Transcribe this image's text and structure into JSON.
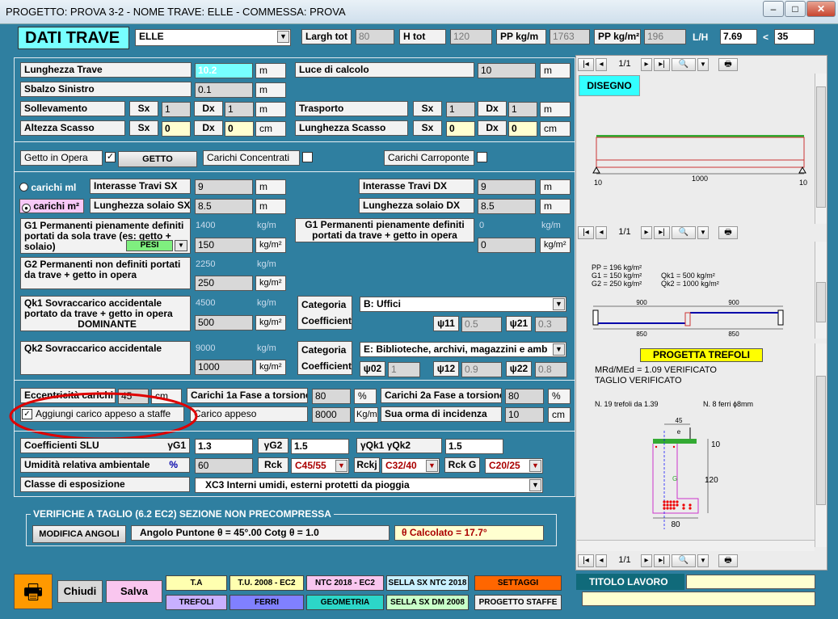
{
  "window": {
    "title": "PROGETTO: PROVA 3-2 - NOME TRAVE: ELLE - COMMESSA: PROVA",
    "min": "–",
    "max": "□",
    "close": "✕"
  },
  "header": {
    "title": "DATI TRAVE",
    "trave": "ELLE",
    "largh_tot_label": "Largh tot",
    "largh_tot": "80",
    "h_tot_label": "H tot",
    "h_tot": "120",
    "pp_kgm_label": "PP kg/m",
    "pp_kgm": "1763",
    "pp_kgm2_label": "PP kg/m²",
    "pp_kgm2": "196",
    "lh_label": "L/H",
    "lh": "7.69",
    "lt": "<",
    "lh_limit": "35"
  },
  "geom": {
    "lunghezza_label": "Lunghezza Trave",
    "lunghezza": "10.2",
    "m": "m",
    "luce_label": "Luce di calcolo",
    "luce": "10",
    "sbalzo_label": "Sbalzo Sinistro",
    "sbalzo": "0.1",
    "sollevamento_label": "Sollevamento",
    "sx": "Sx",
    "dx": "Dx",
    "soll_sx": "1",
    "soll_dx": "1",
    "trasporto_label": "Trasporto",
    "tras_sx": "1",
    "tras_dx": "1",
    "scasso_label": "Altezza Scasso",
    "scasso_sx": "0",
    "scasso_dx": "0",
    "cm": "cm",
    "lscasso_label": "Lunghezza Scasso",
    "lscasso_sx": "0",
    "lscasso_dx": "0"
  },
  "getto": {
    "getto_label": "Getto in Opera",
    "getto_checked": "✓",
    "getto_btn": "GETTO",
    "conc_label": "Carichi Concentrati",
    "carroponte_label": "Carichi Carroponte"
  },
  "loads": {
    "carichi_ml": "carichi ml",
    "carichi_m2": "carichi m²",
    "int_sx_label": "Interasse Travi SX",
    "int_sx": "9",
    "int_dx_label": "Interasse Travi DX",
    "int_dx": "9",
    "lsol_sx_label": "Lunghezza solaio SX",
    "lsol_sx": "8.5",
    "lsol_dx_label": "Lunghezza solaio DX",
    "lsol_dx": "8.5",
    "m": "m",
    "g1_label": "G1  Permanenti pienamente definiti portati da sola trave (es: getto + solaio)",
    "pesi_btn": "PESI",
    "g1_kgm": "1400",
    "kgm": "kg/m",
    "g1_kgm2": "150",
    "kgm2": "kg/m²",
    "g1b_label": "G1  Permanenti pienamente definiti portati da trave + getto in opera",
    "g1b_kgm": "0",
    "g1b_kgm2": "0",
    "g2_label": "G2  Permanenti non definiti portati da trave + getto in opera",
    "g2_kgm": "2250",
    "g2_kgm2": "250",
    "qk1_label": "Qk1   Sovraccarico accidentale portato da trave + getto in opera",
    "qk1_dom": "DOMINANTE",
    "qk1_kgm": "4500",
    "qk1_kgm2": "500",
    "categoria": "Categoria",
    "coefficienti": "Coefficienti",
    "cat1": "B: Uffici",
    "psi11_label": "ψ11",
    "psi11": "0.5",
    "psi21_label": "ψ21",
    "psi21": "0.3",
    "qk2_label": "Qk2  Sovraccarico accidentale",
    "qk2_kgm": "9000",
    "qk2_kgm2": "1000",
    "cat2": "E: Biblioteche, archivi, magazzini e amb",
    "psi02_label": "ψ02",
    "psi02": "1",
    "psi12_label": "ψ12",
    "psi12": "0.9",
    "psi22_label": "ψ22",
    "psi22": "0.8"
  },
  "ecc": {
    "ecc_label": "Eccentricità carichi",
    "ecc": "45",
    "cm": "cm",
    "fase1_label": "Carichi 1a Fase a torsione",
    "fase1": "80",
    "pct": "%",
    "fase2_label": "Carichi 2a Fase a torsione",
    "fase2": "80",
    "aggiungi_label": "Aggiungi carico appeso a staffe",
    "appeso_label": "Carico appeso",
    "appeso": "8000",
    "kgm": "Kg/m",
    "orma_label": "Sua orma di incidenza",
    "orma": "10"
  },
  "slu": {
    "coeff_label": "Coefficienti SLU",
    "g1_label": "γG1",
    "g1": "1.3",
    "g2_label": "γG2",
    "g2": "1.5",
    "q_label": "γQk1  γQk2",
    "q": "1.5",
    "umid_label": "Umidità relativa ambientale",
    "pct": "%",
    "umid": "60",
    "rck_label": "Rck",
    "rck": "C45/55",
    "rckj_label": "Rckj",
    "rckj": "C32/40",
    "rckg_label": "Rck G",
    "rckg": "C20/25",
    "classe_label": "Classe di esposizione",
    "classe": "XC3   Interni umidi, esterni protetti da pioggia"
  },
  "taglio": {
    "title": "VERIFICHE A TAGLIO (6.2 EC2) SEZIONE NON PRECOMPRESSA",
    "modifica_btn": "MODIFICA ANGOLI",
    "angolo": "Angolo Puntone   θ  =  45°.00      Cotg θ = 1.0",
    "calcolato": "θ  Calcolato =  17.7°"
  },
  "viewer": {
    "page": "1/1",
    "disegno_btn": "DISEGNO",
    "span_label": "1000",
    "left_support": "10",
    "right_support": "10",
    "pp": "PP = 196 kg/m²",
    "g1": "G1 = 150 kg/m²",
    "g2": "G2 = 250 kg/m²",
    "qk1": "Qk1 = 500 kg/m²",
    "qk2": "Qk2 = 1000 kg/m²",
    "d1": "900",
    "d2": "900",
    "d3": "850",
    "d4": "850",
    "progetta_btn": "PROGETTA TREFOLI",
    "mrd": "MRd/MEd = 1.09 VERIFICATO",
    "taglio": "TAGLIO VERIFICATO",
    "trefoli": "N. 19 trefoli da 1.39",
    "ferri": "N. 8 ferri  ϕ8mm",
    "dim45": "45",
    "dime": "e",
    "dim10": "10",
    "dim120": "120",
    "dim80": "80",
    "dimG": "G"
  },
  "footer": {
    "chiudi": "Chiudi",
    "salva": "Salva",
    "b_ta": "T.A",
    "b_tu": "T.U. 2008 - EC2",
    "b_ntc": "NTC 2018 - EC2",
    "b_sella1": "SELLA SX NTC 2018",
    "b_sett": "SETTAGGI",
    "b_tref": "TREFOLI",
    "b_ferri": "FERRI",
    "b_geom": "GEOMETRIA",
    "b_sella2": "SELLA SX DM 2008",
    "b_staffe": "PROGETTO STAFFE",
    "titolo": "TITOLO LAVORO"
  },
  "colors": {
    "bg": "#2f7fa0",
    "yellow": "#ffffd0",
    "cyan": "#7fffff",
    "red_annotation": "#e00000"
  }
}
